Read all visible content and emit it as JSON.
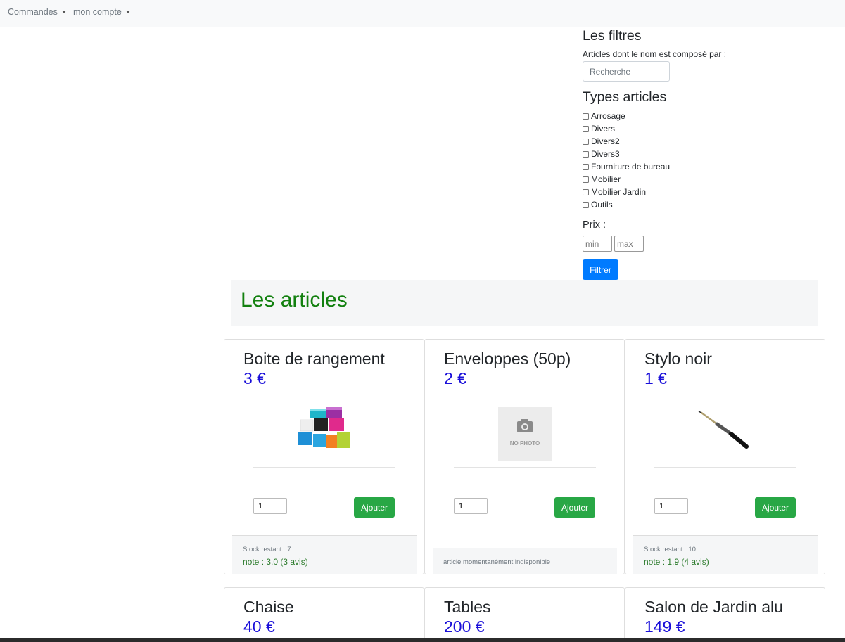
{
  "nav": {
    "commandes": "Commandes",
    "compte": "mon compte"
  },
  "filters": {
    "title": "Les filtres",
    "name_label": "Articles dont le nom est composé par :",
    "search_placeholder": "Recherche",
    "types_title": "Types articles",
    "types": [
      "Arrosage",
      "Divers",
      "Divers2",
      "Divers3",
      "Fourniture de bureau",
      "Mobilier",
      "Mobilier Jardin",
      "Outils"
    ],
    "price_label": "Prix :",
    "min_placeholder": "min",
    "max_placeholder": "max",
    "submit": "Filtrer"
  },
  "articles_title": "Les articles",
  "products": [
    {
      "name": "Boite de rangement",
      "price": "3 €",
      "image": "storage-boxes-photo",
      "qty": "1",
      "button": "Ajouter",
      "stock": "Stock restant : 7",
      "note": "note : 3.0 (3 avis)"
    },
    {
      "name": "Enveloppes (50p)",
      "price": "2 €",
      "image": "no-photo-placeholder",
      "no_photo_text": "NO PHOTO",
      "qty": "1",
      "button": "Ajouter",
      "unavailable": "article momentanément indisponible"
    },
    {
      "name": "Stylo noir",
      "price": "1 €",
      "image": "black-pen-photo",
      "qty": "1",
      "button": "Ajouter",
      "stock": "Stock restant : 10",
      "note": "note : 1.9 (4 avis)"
    },
    {
      "name": "Chaise",
      "price": "40 €"
    },
    {
      "name": "Tables",
      "price": "200 €"
    },
    {
      "name": "Salon de Jardin alu",
      "price": "149 €"
    }
  ],
  "colors": {
    "accent_blue": "#007bff",
    "add_green": "#28a745",
    "title_green": "#12800f",
    "price_blue": "#1a0fd9"
  }
}
